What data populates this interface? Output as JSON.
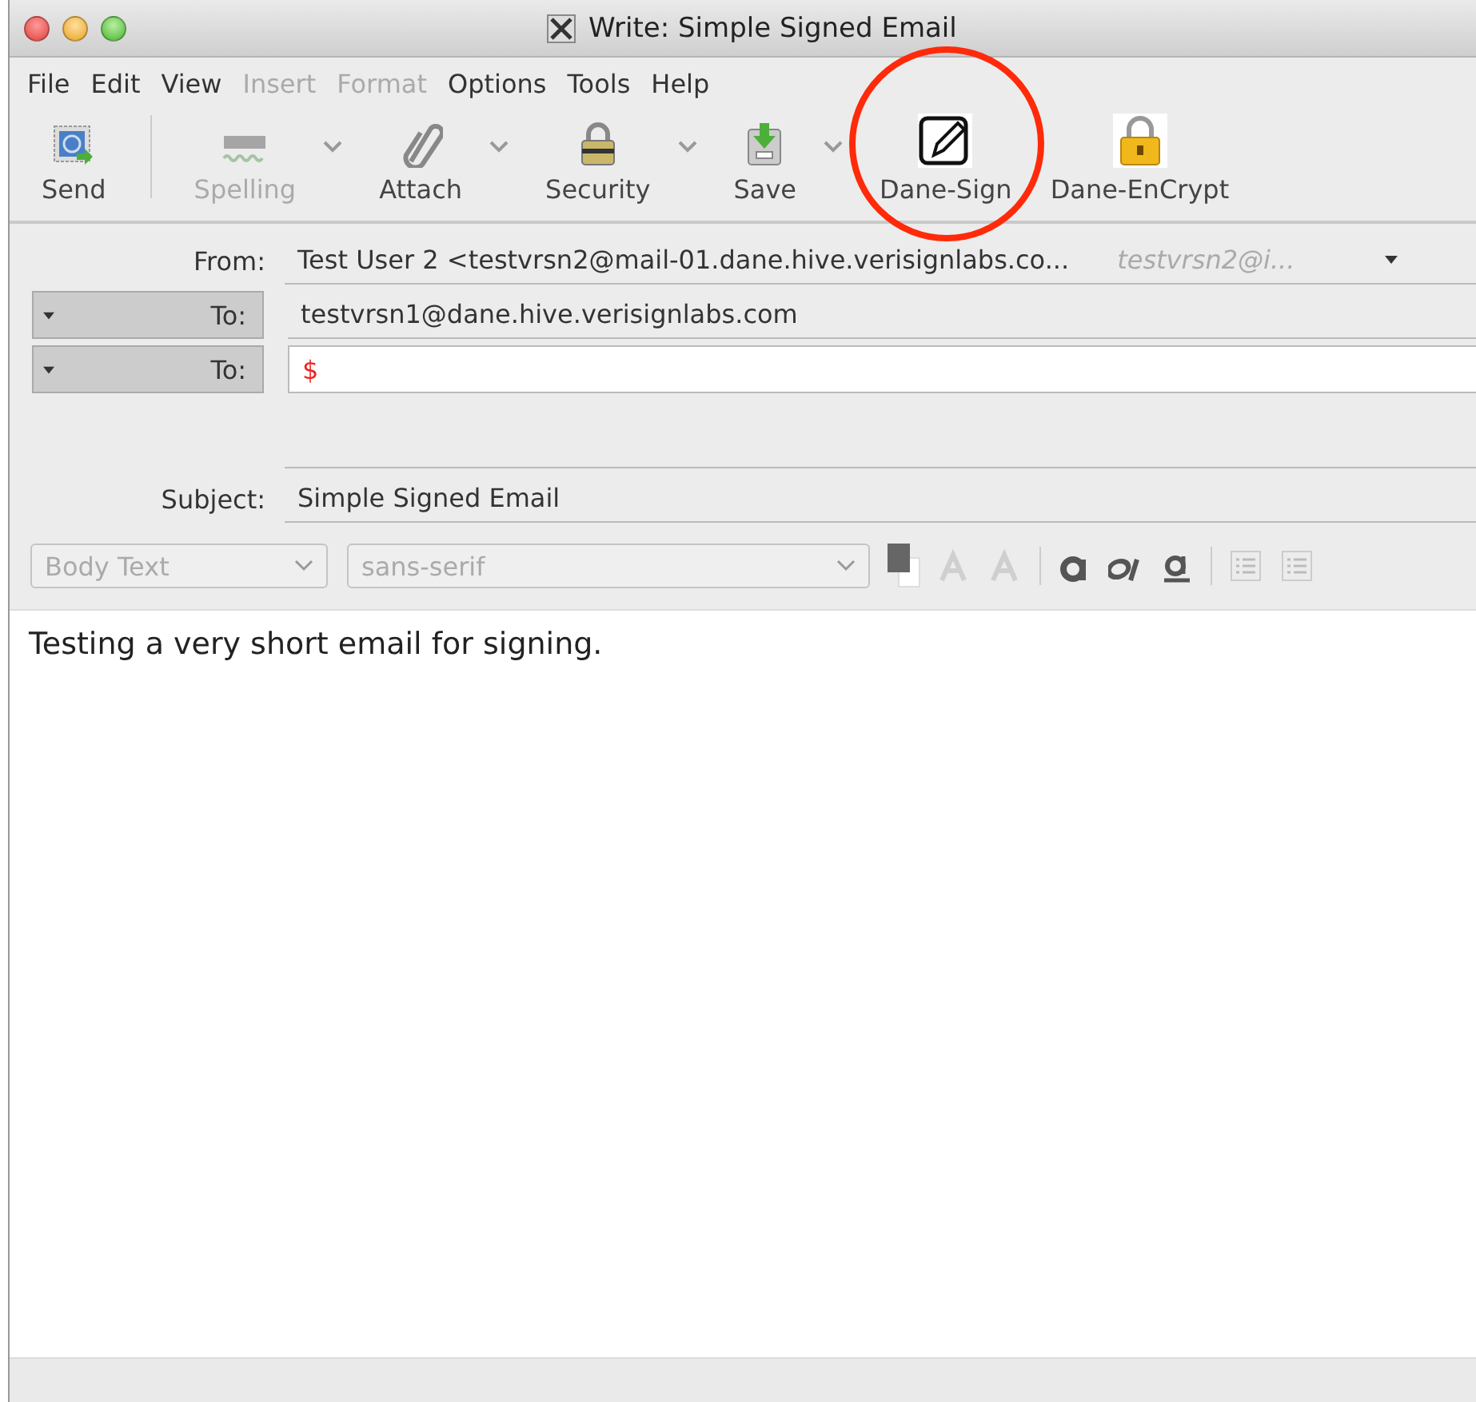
{
  "window": {
    "title": "Write: Simple Signed Email"
  },
  "menu": [
    {
      "label": "File",
      "disabled": false
    },
    {
      "label": "Edit",
      "disabled": false
    },
    {
      "label": "View",
      "disabled": false
    },
    {
      "label": "Insert",
      "disabled": true
    },
    {
      "label": "Format",
      "disabled": true
    },
    {
      "label": "Options",
      "disabled": false
    },
    {
      "label": "Tools",
      "disabled": false
    },
    {
      "label": "Help",
      "disabled": false
    }
  ],
  "toolbar": [
    {
      "kind": "send",
      "label": "Send",
      "disabled": false,
      "dropdown": false
    },
    {
      "kind": "spelling",
      "label": "Spelling",
      "disabled": true,
      "dropdown": true
    },
    {
      "kind": "attach",
      "label": "Attach",
      "disabled": false,
      "dropdown": true
    },
    {
      "kind": "security",
      "label": "Security",
      "disabled": false,
      "dropdown": true
    },
    {
      "kind": "save",
      "label": "Save",
      "disabled": false,
      "dropdown": true
    },
    {
      "kind": "sign",
      "label": "Dane-Sign",
      "disabled": false,
      "dropdown": false
    },
    {
      "kind": "encrypt",
      "label": "Dane-EnCrypt",
      "disabled": false,
      "dropdown": false
    }
  ],
  "from": {
    "label": "From:",
    "value": "Test User 2 <testvrsn2@mail-01.dane.hive.verisignlabs.co...",
    "identity": "testvrsn2@i..."
  },
  "recipients": [
    {
      "label": "To:",
      "value": "testvrsn1@dane.hive.verisignlabs.com",
      "focused": false
    },
    {
      "label": "To:",
      "value": "$",
      "focused": true
    }
  ],
  "subject": {
    "label": "Subject:",
    "value": "Simple Signed Email"
  },
  "format_bar": {
    "paragraph": "Body Text",
    "font": "sans-serif"
  },
  "body": "Testing a very short email for signing."
}
